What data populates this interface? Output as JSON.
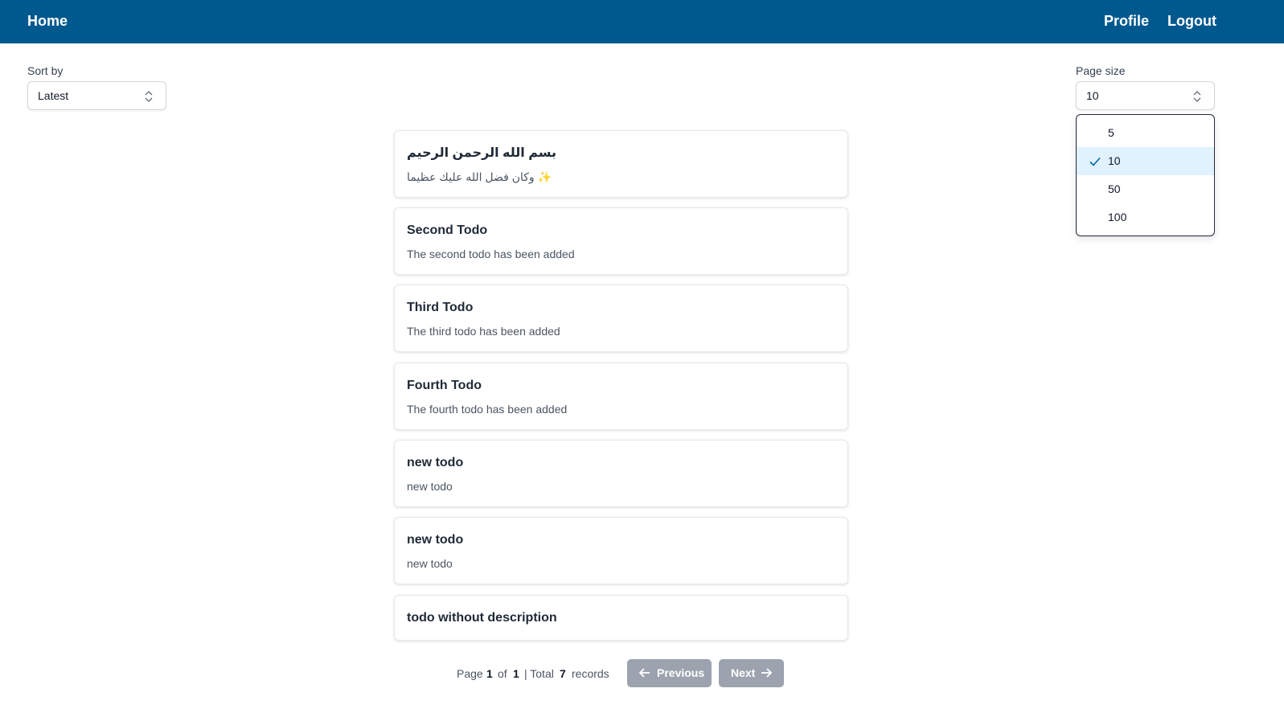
{
  "nav": {
    "home": "Home",
    "profile": "Profile",
    "logout": "Logout"
  },
  "sort": {
    "label": "Sort by",
    "value": "Latest"
  },
  "page_size": {
    "label": "Page size",
    "value": "10",
    "options": [
      "5",
      "10",
      "50",
      "100"
    ],
    "selected_option": "10"
  },
  "todos": [
    {
      "title": "بسم الله الرحمن الرحيم",
      "description": "وكان فضل الله عليك عظيما ✨"
    },
    {
      "title": "Second Todo",
      "description": "The second todo has been added"
    },
    {
      "title": "Third Todo",
      "description": "The third todo has been added"
    },
    {
      "title": "Fourth Todo",
      "description": "The fourth todo has been added"
    },
    {
      "title": "new todo",
      "description": "new todo"
    },
    {
      "title": "new todo",
      "description": "new todo"
    },
    {
      "title": "todo without description",
      "description": ""
    }
  ],
  "pagination": {
    "page_word": "Page",
    "current_page": "1",
    "of_word": "of",
    "total_pages": "1",
    "total_word": "| Total",
    "total_records": "7",
    "records_word": "records",
    "previous_label": "Previous",
    "next_label": "Next"
  },
  "colors": {
    "navbar": "#00598e",
    "selected_option_bg": "#e0f2fe",
    "check": "#0369a1",
    "disabled_button": "#9ca3af"
  }
}
